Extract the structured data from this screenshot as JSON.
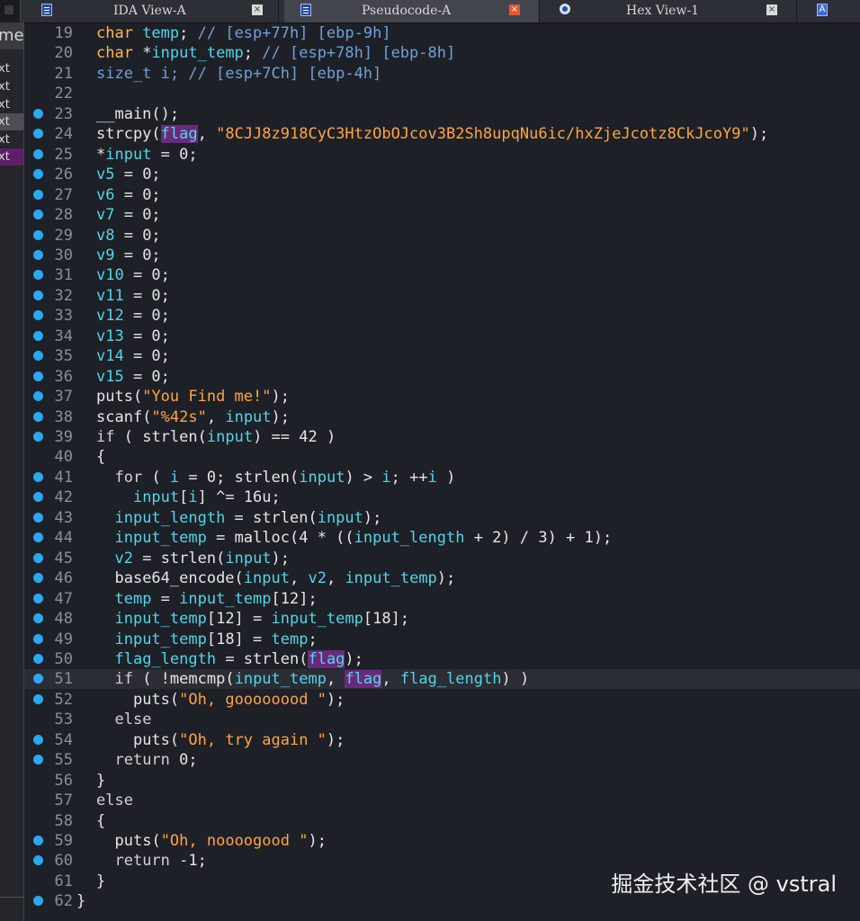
{
  "tabs": [
    {
      "label": "IDA View-A",
      "icon": "ida-view-icon",
      "active": false
    },
    {
      "label": "Pseudocode-A",
      "icon": "pseudocode-icon",
      "active": true
    },
    {
      "label": "Hex View-1",
      "icon": "hex-view-icon",
      "active": false
    },
    {
      "label": "",
      "icon": "structures-icon",
      "active": false
    }
  ],
  "tab_close_glyph": "×",
  "structures_glyph": "A",
  "side_panel": {
    "header": "me",
    "items": [
      "xt",
      "xt",
      "xt",
      "xt",
      "xt",
      "xt"
    ]
  },
  "code_lines": [
    {
      "n": "19",
      "bp": false,
      "tokens": [
        [
          "typ",
          "char "
        ],
        [
          "var",
          "temp"
        ],
        [
          "",
          "; "
        ],
        [
          "cmt",
          "// [esp+77h] [ebp-9h]"
        ]
      ]
    },
    {
      "n": "20",
      "bp": false,
      "tokens": [
        [
          "typ",
          "char "
        ],
        [
          "",
          "*"
        ],
        [
          "var",
          "input_temp"
        ],
        [
          "",
          "; "
        ],
        [
          "cmt",
          "// [esp+78h] [ebp-8h]"
        ]
      ]
    },
    {
      "n": "21",
      "bp": false,
      "tokens": [
        [
          "cmt",
          "size_t i; // [esp+7Ch] [ebp-4h]"
        ]
      ]
    },
    {
      "n": "22",
      "bp": false,
      "tokens": []
    },
    {
      "n": "23",
      "bp": true,
      "tokens": [
        [
          "fn",
          "__main"
        ],
        [
          "",
          "();"
        ]
      ]
    },
    {
      "n": "24",
      "bp": true,
      "tokens": [
        [
          "fn",
          "strcpy"
        ],
        [
          "",
          "("
        ],
        [
          "hl",
          "flag"
        ],
        [
          "",
          ", "
        ],
        [
          "str",
          "\"8CJJ8z918CyC3HtzObOJcov3B2Sh8upqNu6ic/hxZjeJcotz8CkJcoY9\""
        ],
        [
          "",
          ");"
        ]
      ]
    },
    {
      "n": "25",
      "bp": true,
      "tokens": [
        [
          "",
          "*"
        ],
        [
          "var",
          "input"
        ],
        [
          "",
          " = 0;"
        ]
      ]
    },
    {
      "n": "26",
      "bp": true,
      "tokens": [
        [
          "var",
          "v5"
        ],
        [
          "",
          " = 0;"
        ]
      ]
    },
    {
      "n": "27",
      "bp": true,
      "tokens": [
        [
          "var",
          "v6"
        ],
        [
          "",
          " = 0;"
        ]
      ]
    },
    {
      "n": "28",
      "bp": true,
      "tokens": [
        [
          "var",
          "v7"
        ],
        [
          "",
          " = 0;"
        ]
      ]
    },
    {
      "n": "29",
      "bp": true,
      "tokens": [
        [
          "var",
          "v8"
        ],
        [
          "",
          " = 0;"
        ]
      ]
    },
    {
      "n": "30",
      "bp": true,
      "tokens": [
        [
          "var",
          "v9"
        ],
        [
          "",
          " = 0;"
        ]
      ]
    },
    {
      "n": "31",
      "bp": true,
      "tokens": [
        [
          "var",
          "v10"
        ],
        [
          "",
          " = 0;"
        ]
      ]
    },
    {
      "n": "32",
      "bp": true,
      "tokens": [
        [
          "var",
          "v11"
        ],
        [
          "",
          " = 0;"
        ]
      ]
    },
    {
      "n": "33",
      "bp": true,
      "tokens": [
        [
          "var",
          "v12"
        ],
        [
          "",
          " = 0;"
        ]
      ]
    },
    {
      "n": "34",
      "bp": true,
      "tokens": [
        [
          "var",
          "v13"
        ],
        [
          "",
          " = 0;"
        ]
      ]
    },
    {
      "n": "35",
      "bp": true,
      "tokens": [
        [
          "var",
          "v14"
        ],
        [
          "",
          " = 0;"
        ]
      ]
    },
    {
      "n": "36",
      "bp": true,
      "tokens": [
        [
          "var",
          "v15"
        ],
        [
          "",
          " = 0;"
        ]
      ]
    },
    {
      "n": "37",
      "bp": true,
      "tokens": [
        [
          "fn",
          "puts"
        ],
        [
          "",
          "("
        ],
        [
          "str",
          "\"You Find me!\""
        ],
        [
          "",
          ");"
        ]
      ]
    },
    {
      "n": "38",
      "bp": true,
      "tokens": [
        [
          "fn",
          "scanf"
        ],
        [
          "",
          "("
        ],
        [
          "str",
          "\"%42s\""
        ],
        [
          "",
          ", "
        ],
        [
          "var",
          "input"
        ],
        [
          "",
          ");"
        ]
      ]
    },
    {
      "n": "39",
      "bp": true,
      "tokens": [
        [
          "kw",
          "if"
        ],
        [
          "",
          " ( "
        ],
        [
          "fn",
          "strlen"
        ],
        [
          "",
          "("
        ],
        [
          "var",
          "input"
        ],
        [
          "",
          ") == 42 )"
        ]
      ]
    },
    {
      "n": "40",
      "bp": false,
      "tokens": [
        [
          "",
          "{"
        ]
      ]
    },
    {
      "n": "41",
      "bp": true,
      "tokens": [
        [
          "",
          "  "
        ],
        [
          "kw",
          "for"
        ],
        [
          "",
          " ( "
        ],
        [
          "var",
          "i"
        ],
        [
          "",
          " = 0; "
        ],
        [
          "fn",
          "strlen"
        ],
        [
          "",
          "("
        ],
        [
          "var",
          "input"
        ],
        [
          "",
          ") > "
        ],
        [
          "var",
          "i"
        ],
        [
          "",
          "; ++"
        ],
        [
          "var",
          "i"
        ],
        [
          "",
          " )"
        ]
      ]
    },
    {
      "n": "42",
      "bp": true,
      "tokens": [
        [
          "",
          "    "
        ],
        [
          "var",
          "input"
        ],
        [
          "",
          "["
        ],
        [
          "var",
          "i"
        ],
        [
          "",
          "] ^= 16u;"
        ]
      ]
    },
    {
      "n": "43",
      "bp": true,
      "tokens": [
        [
          "",
          "  "
        ],
        [
          "var",
          "input_length"
        ],
        [
          "",
          " = "
        ],
        [
          "fn",
          "strlen"
        ],
        [
          "",
          "("
        ],
        [
          "var",
          "input"
        ],
        [
          "",
          ");"
        ]
      ]
    },
    {
      "n": "44",
      "bp": true,
      "tokens": [
        [
          "",
          "  "
        ],
        [
          "var",
          "input_temp"
        ],
        [
          "",
          " = "
        ],
        [
          "fn",
          "malloc"
        ],
        [
          "",
          "(4 * (("
        ],
        [
          "var",
          "input_length"
        ],
        [
          "",
          " + 2) / 3) + 1);"
        ]
      ]
    },
    {
      "n": "45",
      "bp": true,
      "tokens": [
        [
          "",
          "  "
        ],
        [
          "var",
          "v2"
        ],
        [
          "",
          " = "
        ],
        [
          "fn",
          "strlen"
        ],
        [
          "",
          "("
        ],
        [
          "var",
          "input"
        ],
        [
          "",
          ");"
        ]
      ]
    },
    {
      "n": "46",
      "bp": true,
      "tokens": [
        [
          "",
          "  "
        ],
        [
          "fn",
          "base64_encode"
        ],
        [
          "",
          "("
        ],
        [
          "var",
          "input"
        ],
        [
          "",
          ", "
        ],
        [
          "var",
          "v2"
        ],
        [
          "",
          ", "
        ],
        [
          "var",
          "input_temp"
        ],
        [
          "",
          ");"
        ]
      ]
    },
    {
      "n": "47",
      "bp": true,
      "tokens": [
        [
          "",
          "  "
        ],
        [
          "var",
          "temp"
        ],
        [
          "",
          " = "
        ],
        [
          "var",
          "input_temp"
        ],
        [
          "",
          "[12];"
        ]
      ]
    },
    {
      "n": "48",
      "bp": true,
      "tokens": [
        [
          "",
          "  "
        ],
        [
          "var",
          "input_temp"
        ],
        [
          "",
          "[12] = "
        ],
        [
          "var",
          "input_temp"
        ],
        [
          "",
          "[18];"
        ]
      ]
    },
    {
      "n": "49",
      "bp": true,
      "tokens": [
        [
          "",
          "  "
        ],
        [
          "var",
          "input_temp"
        ],
        [
          "",
          "[18] = "
        ],
        [
          "var",
          "temp"
        ],
        [
          "",
          ";"
        ]
      ]
    },
    {
      "n": "50",
      "bp": true,
      "tokens": [
        [
          "",
          "  "
        ],
        [
          "var",
          "flag_length"
        ],
        [
          "",
          " = "
        ],
        [
          "fn",
          "strlen"
        ],
        [
          "",
          "("
        ],
        [
          "hl",
          "flag"
        ],
        [
          "",
          ");"
        ]
      ]
    },
    {
      "n": "51",
      "bp": true,
      "current": true,
      "tokens": [
        [
          "",
          "  "
        ],
        [
          "kw",
          "if"
        ],
        [
          "",
          " ( !"
        ],
        [
          "fn",
          "memcmp"
        ],
        [
          "",
          "("
        ],
        [
          "var",
          "input_temp"
        ],
        [
          "",
          ", "
        ],
        [
          "hl",
          "flag"
        ],
        [
          "",
          ", "
        ],
        [
          "var",
          "flag_length"
        ],
        [
          "",
          ") )"
        ]
      ]
    },
    {
      "n": "52",
      "bp": true,
      "tokens": [
        [
          "",
          "    "
        ],
        [
          "fn",
          "puts"
        ],
        [
          "",
          "("
        ],
        [
          "str",
          "\"Oh, goooooood \""
        ],
        [
          "",
          ");"
        ]
      ]
    },
    {
      "n": "53",
      "bp": false,
      "tokens": [
        [
          "",
          "  "
        ],
        [
          "kw",
          "else"
        ]
      ]
    },
    {
      "n": "54",
      "bp": true,
      "tokens": [
        [
          "",
          "    "
        ],
        [
          "fn",
          "puts"
        ],
        [
          "",
          "("
        ],
        [
          "str",
          "\"Oh, try again \""
        ],
        [
          "",
          ");"
        ]
      ]
    },
    {
      "n": "55",
      "bp": true,
      "tokens": [
        [
          "",
          "  "
        ],
        [
          "kw",
          "return"
        ],
        [
          "",
          " 0;"
        ]
      ]
    },
    {
      "n": "56",
      "bp": false,
      "tokens": [
        [
          "",
          "}"
        ]
      ]
    },
    {
      "n": "57",
      "bp": false,
      "tokens": [
        [
          "kw",
          "else"
        ]
      ]
    },
    {
      "n": "58",
      "bp": false,
      "tokens": [
        [
          "",
          "{"
        ]
      ]
    },
    {
      "n": "59",
      "bp": true,
      "tokens": [
        [
          "",
          "  "
        ],
        [
          "fn",
          "puts"
        ],
        [
          "",
          "("
        ],
        [
          "str",
          "\"Oh, noooogood \""
        ],
        [
          "",
          ");"
        ]
      ]
    },
    {
      "n": "60",
      "bp": true,
      "tokens": [
        [
          "",
          "  "
        ],
        [
          "kw",
          "return"
        ],
        [
          "",
          " -1;"
        ]
      ]
    },
    {
      "n": "61",
      "bp": false,
      "tokens": [
        [
          "",
          "}"
        ]
      ]
    },
    {
      "n": "62",
      "bp": true,
      "closing": true,
      "tokens": [
        [
          "",
          "}"
        ]
      ]
    }
  ],
  "watermark": "掘金技术社区 @ vstral",
  "colors": {
    "background": "#1e2027",
    "variable": "#4fd6e8",
    "string": "#ffa53f",
    "comment": "#6fa0d8",
    "highlight": "#6a2a7c",
    "breakpoint": "#2aa8f2"
  }
}
